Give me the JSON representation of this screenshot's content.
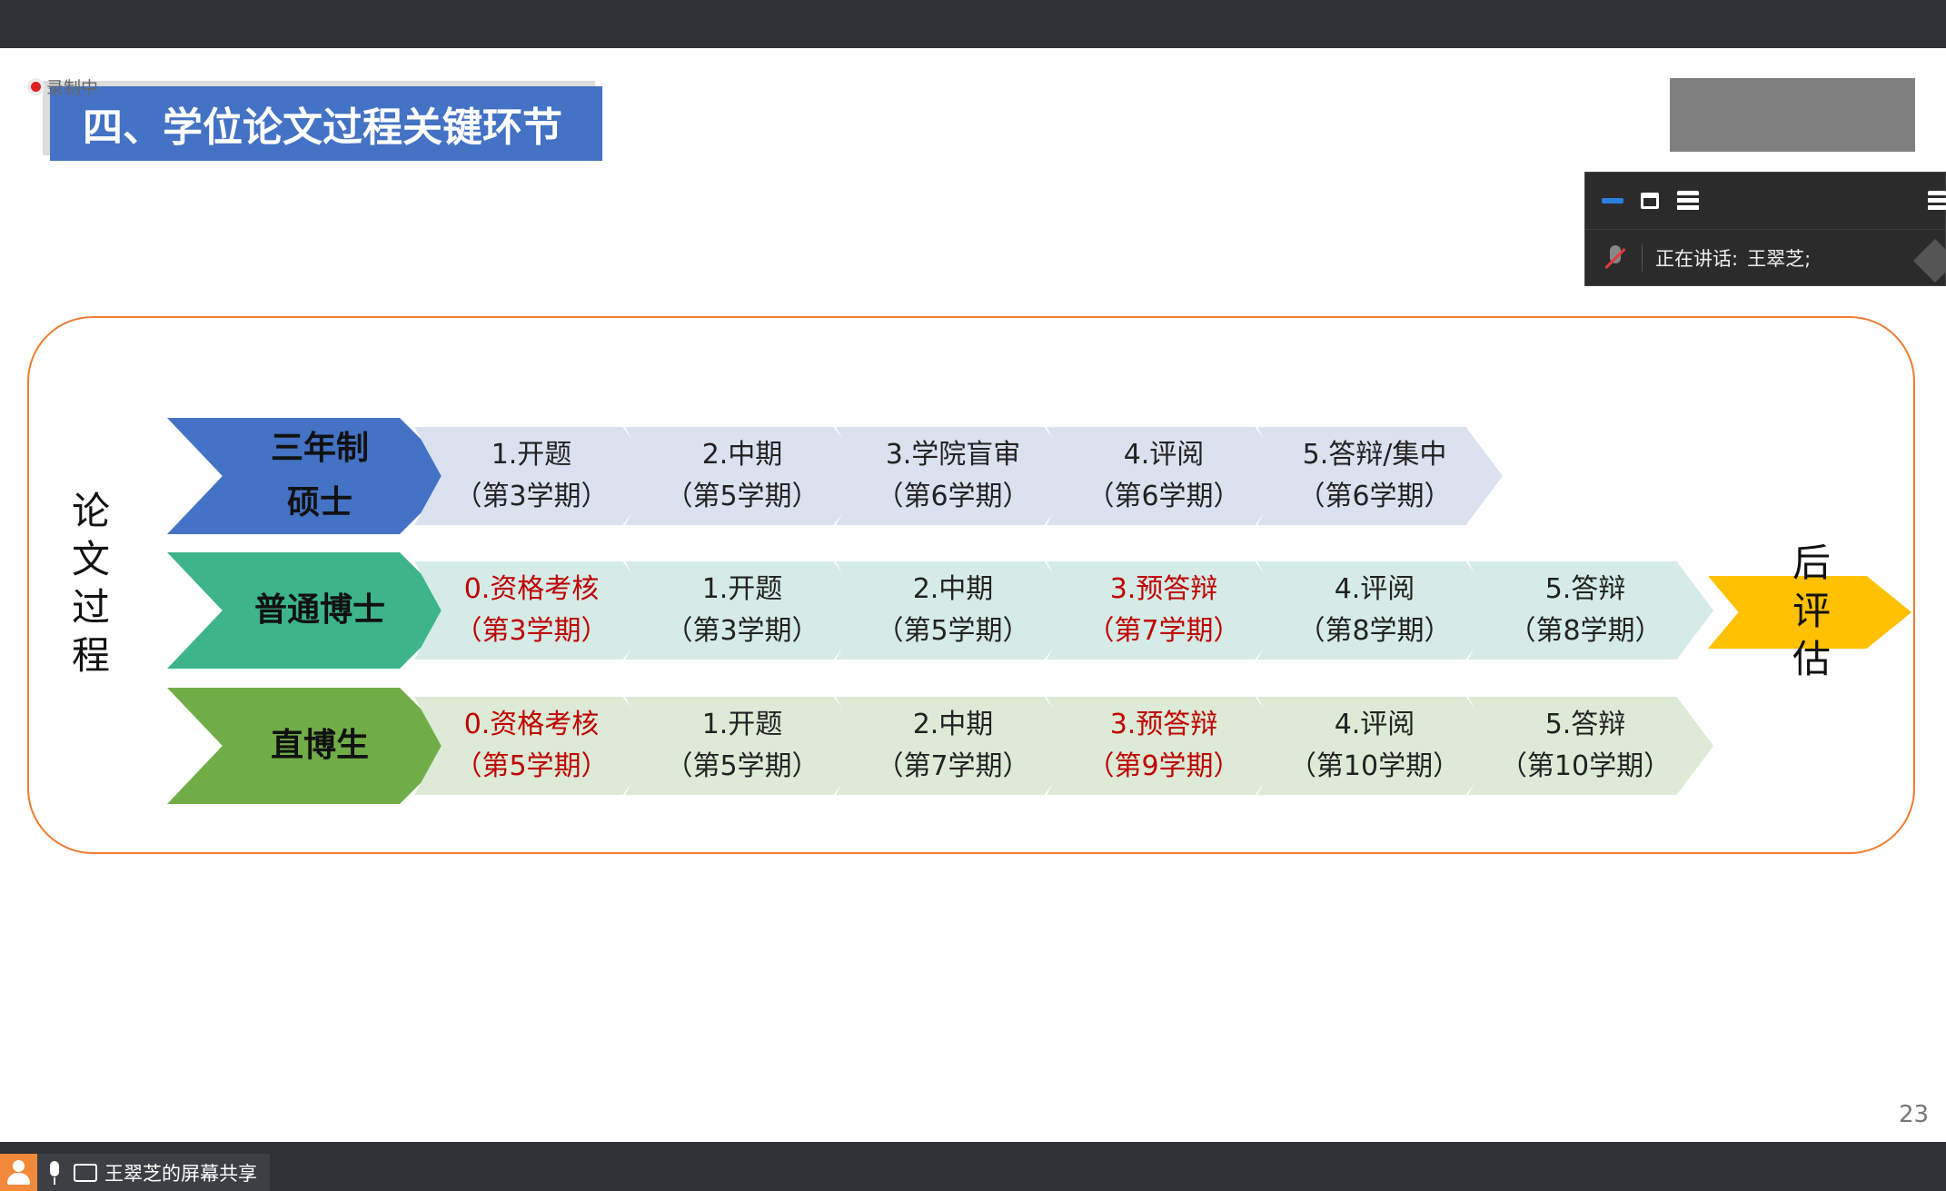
{
  "recording": {
    "label": "录制中"
  },
  "slide": {
    "title": "四、学位论文过程关键环节",
    "side_left": [
      "论",
      "文",
      "过",
      "程"
    ],
    "side_right": [
      "后",
      "评",
      "估"
    ],
    "page_number": "23"
  },
  "rows": [
    {
      "head_lines": [
        "三年制",
        "硕士"
      ],
      "color": "#4472c4",
      "step_bg": "#dae1ef",
      "steps": [
        {
          "label": "1.开题",
          "term": "（第3学期）",
          "highlight": false
        },
        {
          "label": "2.中期",
          "term": "（第5学期）",
          "highlight": false
        },
        {
          "label": "3.学院盲审",
          "term": "（第6学期）",
          "highlight": false
        },
        {
          "label": "4.评阅",
          "term": "（第6学期）",
          "highlight": false
        },
        {
          "label": "5.答辩/集中",
          "term": "（第6学期）",
          "highlight": false
        }
      ]
    },
    {
      "head_lines": [
        "普通博士"
      ],
      "color": "#3db48a",
      "step_bg": "#d5ebe6",
      "steps": [
        {
          "label": "0.资格考核",
          "term": "（第3学期）",
          "highlight": true
        },
        {
          "label": "1.开题",
          "term": "（第3学期）",
          "highlight": false
        },
        {
          "label": "2.中期",
          "term": "（第5学期）",
          "highlight": false
        },
        {
          "label": "3.预答辩",
          "term": "（第7学期）",
          "highlight": true
        },
        {
          "label": "4.评阅",
          "term": "（第8学期）",
          "highlight": false
        },
        {
          "label": "5.答辩",
          "term": "（第8学期）",
          "highlight": false
        }
      ]
    },
    {
      "head_lines": [
        "直博生"
      ],
      "color": "#70ad47",
      "step_bg": "#dcead6",
      "steps": [
        {
          "label": "0.资格考核",
          "term": "（第5学期）",
          "highlight": true
        },
        {
          "label": "1.开题",
          "term": "（第5学期）",
          "highlight": false
        },
        {
          "label": "2.中期",
          "term": "（第7学期）",
          "highlight": false
        },
        {
          "label": "3.预答辩",
          "term": "（第9学期）",
          "highlight": true
        },
        {
          "label": "4.评阅",
          "term": "（第10学期）",
          "highlight": false
        },
        {
          "label": "5.答辩",
          "term": "（第10学期）",
          "highlight": false
        }
      ]
    }
  ],
  "colors": {
    "highlight_text": "#c00000",
    "frame_border": "#ed7d31",
    "after_arrow": "#ffc000"
  },
  "floating_panel": {
    "speaking_label": "正在讲话:",
    "speaker_name": "王翠芝;",
    "icons": [
      "minimize-icon",
      "maximize-icon",
      "list-icon",
      "menu-icon",
      "mic-muted-icon"
    ]
  },
  "screen_share": {
    "label": "王翠芝的屏幕共享",
    "icons": [
      "user-icon",
      "mic-icon",
      "screen-share-icon"
    ]
  }
}
